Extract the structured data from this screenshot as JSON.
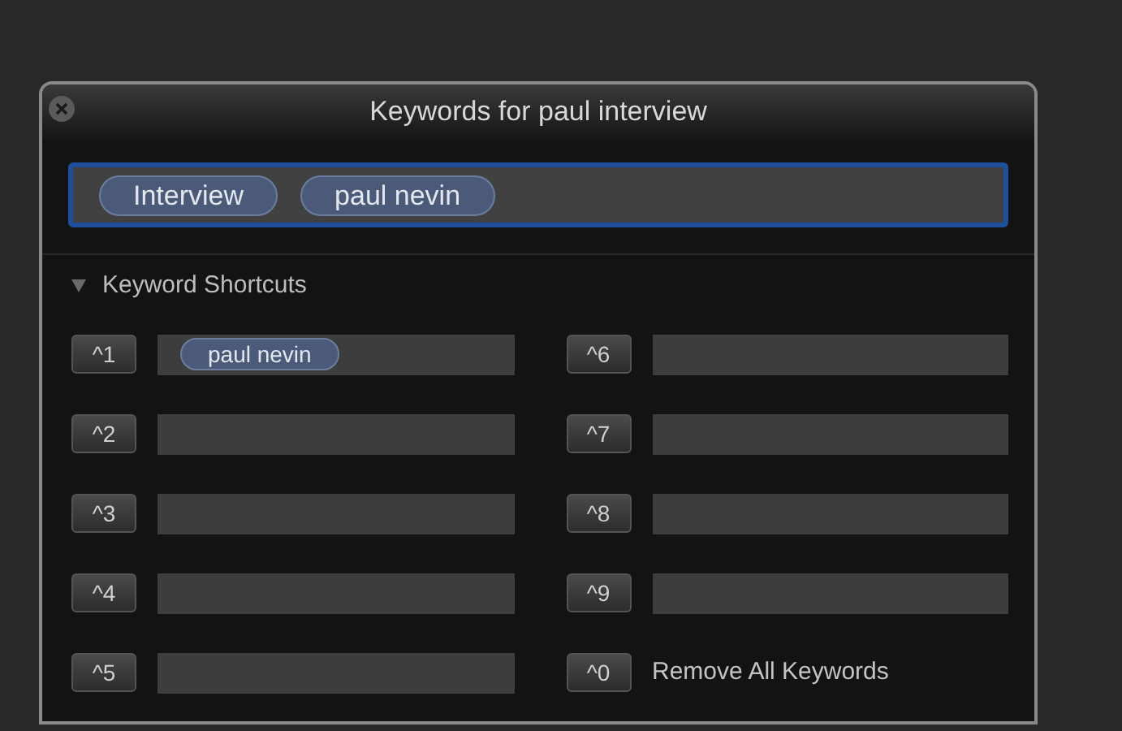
{
  "window": {
    "title": "Keywords for paul interview"
  },
  "keyword_field": {
    "tokens": [
      "Interview",
      "paul nevin"
    ]
  },
  "shortcuts_section": {
    "title": "Keyword Shortcuts",
    "expanded": true,
    "shortcuts": [
      {
        "key": "^1",
        "kind": "field",
        "keywords": [
          "paul nevin"
        ]
      },
      {
        "key": "^2",
        "kind": "field"
      },
      {
        "key": "^3",
        "kind": "field"
      },
      {
        "key": "^4",
        "kind": "field"
      },
      {
        "key": "^5",
        "kind": "field"
      },
      {
        "key": "^6",
        "kind": "field"
      },
      {
        "key": "^7",
        "kind": "field"
      },
      {
        "key": "^8",
        "kind": "field"
      },
      {
        "key": "^9",
        "kind": "field"
      },
      {
        "key": "^0",
        "kind": "action",
        "label": "Remove All Keywords"
      }
    ]
  }
}
